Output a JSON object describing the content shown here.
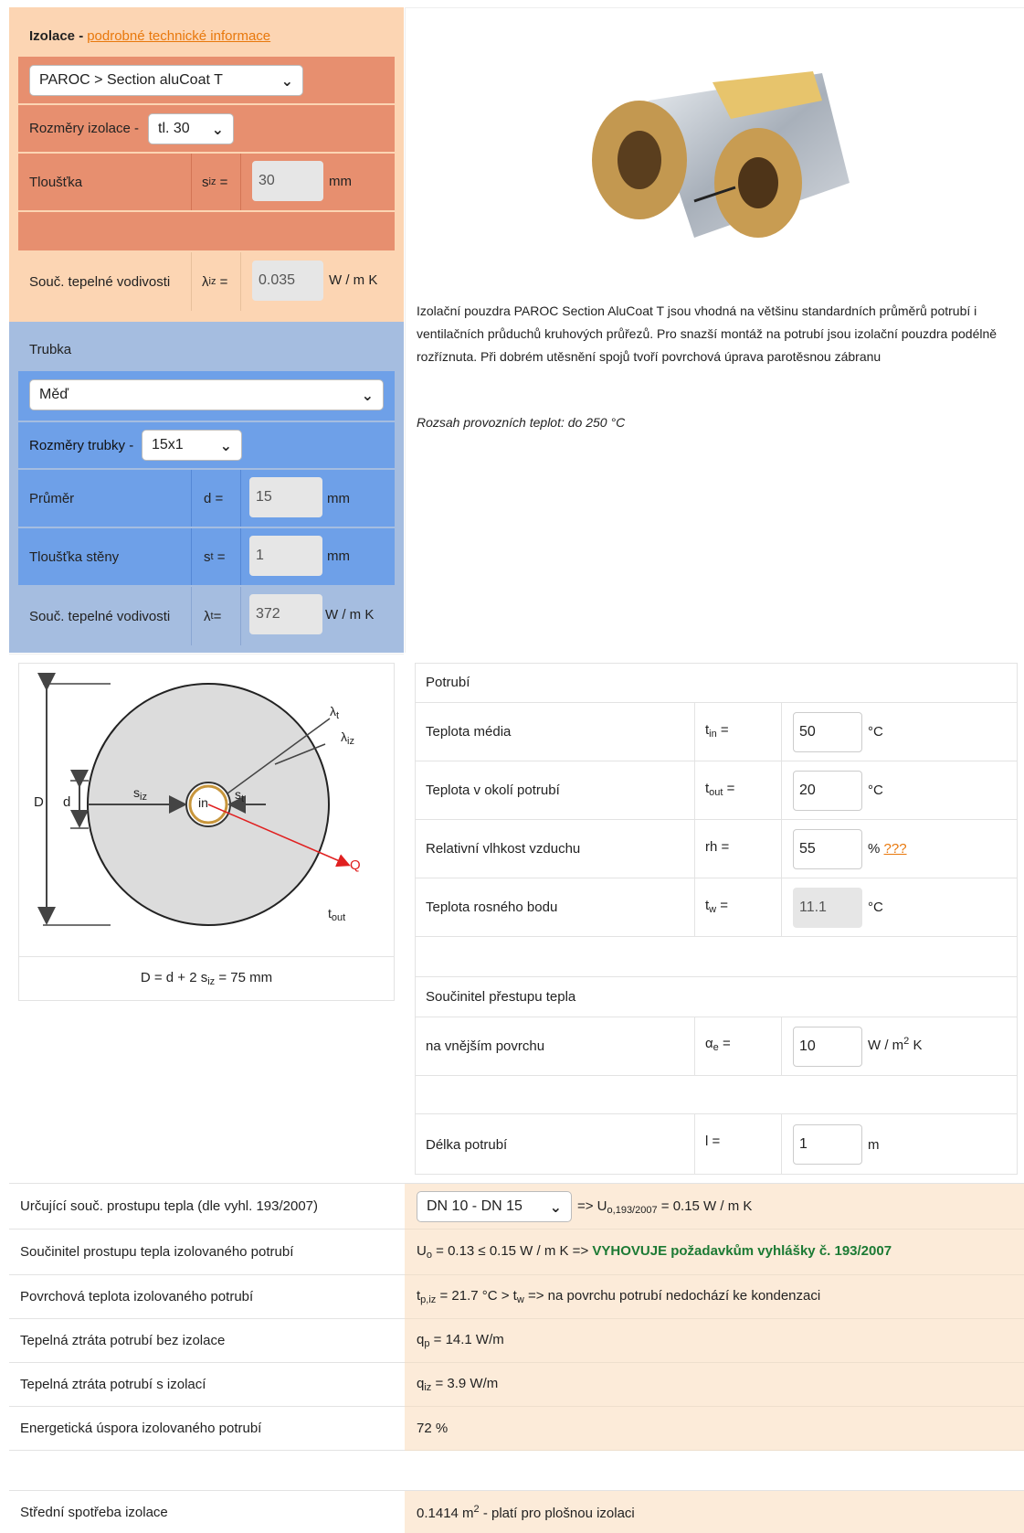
{
  "insulation": {
    "header_label": "Izolace - ",
    "header_link": "podrobné technické informace",
    "product_select": "PAROC > Section aluCoat T",
    "dims_label": "Rozměry izolace - ",
    "dims_select": "tl. 30",
    "thickness_label": "Tloušťka",
    "thickness_sym": "s",
    "thickness_sub": "iz",
    "thickness_value": "30",
    "thickness_unit": "mm",
    "conductivity_label": "Souč. tepelné vodivosti",
    "conductivity_sym": "λ",
    "conductivity_sub": "iz",
    "conductivity_value": "0.035",
    "conductivity_unit": "W / m K"
  },
  "pipe": {
    "header_label": "Trubka",
    "material_select": "Měď",
    "dims_label": "Rozměry trubky - ",
    "dims_select": "15x1",
    "diameter_label": "Průměr",
    "diameter_sym": "d =",
    "diameter_value": "15",
    "diameter_unit": "mm",
    "wall_label": "Tloušťka stěny",
    "wall_sym": "s",
    "wall_sub": "t",
    "wall_value": "1",
    "wall_unit": "mm",
    "conductivity_label": "Souč. tepelné vodivosti",
    "conductivity_sym": "λ",
    "conductivity_sub": "t",
    "conductivity_value": "372",
    "conductivity_unit": "W / m K"
  },
  "product": {
    "description": "Izolační pouzdra PAROC Section AluCoat T jsou vhodná na většinu standardních průměrů potrubí i ventilačních průduchů kruhových průřezů. Pro snazší montáž na potrubí jsou izolační pouzdra podélně rozříznuta. Při dobrém utěsnění spojů tvoří povrchová úprava parotěsnou zábranu",
    "temperature_range": "Rozsah provozních teplot: do 250 °C"
  },
  "diagram": {
    "label_D": "D",
    "label_d": "d",
    "label_siz": "s",
    "label_siz_sub": "iz",
    "label_in": "in",
    "label_st": "s",
    "label_st_sub": "t",
    "label_lt": "λ",
    "label_lt_sub": "t",
    "label_liz": "λ",
    "label_liz_sub": "iz",
    "label_Q": "Q",
    "label_tout": "t",
    "label_tout_sub": "out",
    "formula_pre": "D = d + 2 s",
    "formula_sub": "iz",
    "formula_post": " = 75 mm"
  },
  "piping": {
    "header_label": "Potrubí",
    "t_in_label": "Teplota média",
    "t_in_sym": "t",
    "t_in_sub": "in",
    "t_in_value": "50",
    "t_in_unit": "°C",
    "t_out_label": "Teplota v okolí potrubí",
    "t_out_sym": "t",
    "t_out_sub": "out",
    "t_out_value": "20",
    "t_out_unit": "°C",
    "rh_label": "Relativní vlhkost vzduchu",
    "rh_sym": "rh =",
    "rh_value": "55",
    "rh_unit": "% ",
    "rh_link": "???",
    "dew_label": "Teplota rosného bodu",
    "dew_sym": "t",
    "dew_sub": "w",
    "dew_value": "11.1",
    "dew_unit": "°C",
    "htc_header": "Součinitel přestupu tepla",
    "htc_label": "na vnějším povrchu",
    "htc_sym": "α",
    "htc_sub": "e",
    "htc_value": "10",
    "htc_unit_pre": "W / m",
    "htc_unit_sup": "2",
    "htc_unit_post": " K",
    "length_label": "Délka potrubí",
    "length_sym": "l =",
    "length_value": "1",
    "length_unit": "m"
  },
  "results": {
    "r1_label": "Určující souč. prostupu tepla (dle vyhl. 193/2007)",
    "r1_select": "DN 10 - DN 15",
    "r1_pre": "=> U",
    "r1_sub": "o,193/2007",
    "r1_post": " = 0.15 W / m K",
    "r2_label": "Součinitel prostupu tepla izolovaného potrubí",
    "r2_pre": "U",
    "r2_sub": "o",
    "r2_post": " = 0.13 ≤ 0.15 W / m K => ",
    "r2_ok": "VYHOVUJE požadavkům vyhlášky č. 193/2007",
    "r3_label": "Povrchová teplota izolovaného potrubí",
    "r3_pre": "t",
    "r3_sub": "p,iz",
    "r3_mid": " = 21.7 °C > t",
    "r3_sub2": "w",
    "r3_post": " => na povrchu potrubí nedochází ke kondenzaci",
    "r4_label": "Tepelná ztráta potrubí bez izolace",
    "r4_pre": "q",
    "r4_sub": "p",
    "r4_post": " = 14.1 W/m",
    "r5_label": "Tepelná ztráta potrubí s izolací",
    "r5_pre": "q",
    "r5_sub": "iz",
    "r5_post": " = 3.9 W/m",
    "r6_label": "Energetická úspora izolovaného potrubí",
    "r6_value": "72 %",
    "r7_label": "Střední spotřeba izolace",
    "r7_pre": "0.1414 m",
    "r7_sup": "2",
    "r7_post": " - platí pro plošnou izolaci"
  },
  "colors": {
    "insulation_light": "#fcd5b3",
    "insulation_row": "#e78f6f",
    "pipe_light": "#a5bde0",
    "pipe_row": "#6ea0e8",
    "result_bg": "#fcebd9",
    "link": "#e8780c",
    "ok_green": "#1c7a34"
  }
}
